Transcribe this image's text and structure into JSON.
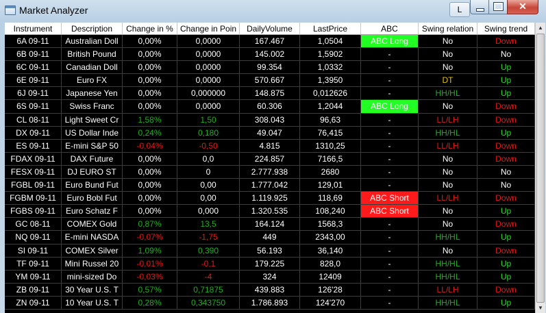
{
  "window": {
    "title": "Market Analyzer",
    "l_button": "L",
    "close_glyph": "✕"
  },
  "columns": [
    "Instrument",
    "Description",
    "Change in %",
    "Change in Poin",
    "DailyVolume",
    "LastPrice",
    "ABC",
    "Swing relation",
    "Swing trend"
  ],
  "colors": {
    "neutral": "#ffffff",
    "positive": "#1fae1f",
    "negative": "#e01818",
    "dt": "#e6c200",
    "abc_long": "#22ff22",
    "abc_short": "#ff1b1b",
    "up": "#2cd82c",
    "down": "#e01818"
  },
  "rows": [
    {
      "instrument": "6A 09-11",
      "description": "Australian Doll",
      "change_pct": "0,00%",
      "change_pts": "0,0000",
      "volume": "167.467",
      "last": "1,0504",
      "abc": "ABC Long",
      "swing_rel": "No",
      "swing_trend": "Down",
      "chg_color": "neutral",
      "rel_color": "neutral",
      "trend_color": "down"
    },
    {
      "instrument": "6B 09-11",
      "description": "British Pound",
      "change_pct": "0,00%",
      "change_pts": "0,0000",
      "volume": "145.002",
      "last": "1,5902",
      "abc": "-",
      "swing_rel": "No",
      "swing_trend": "No",
      "chg_color": "neutral",
      "rel_color": "neutral",
      "trend_color": "neutral"
    },
    {
      "instrument": "6C 09-11",
      "description": "Canadian Doll",
      "change_pct": "0,00%",
      "change_pts": "0,0000",
      "volume": "99.354",
      "last": "1,0332",
      "abc": "-",
      "swing_rel": "No",
      "swing_trend": "Up",
      "chg_color": "neutral",
      "rel_color": "neutral",
      "trend_color": "up"
    },
    {
      "instrument": "6E 09-11",
      "description": "Euro FX",
      "change_pct": "0,00%",
      "change_pts": "0,0000",
      "volume": "570.667",
      "last": "1,3950",
      "abc": "-",
      "swing_rel": "DT",
      "swing_trend": "Up",
      "chg_color": "neutral",
      "rel_color": "dt",
      "trend_color": "up"
    },
    {
      "instrument": "6J 09-11",
      "description": "Japanese Yen",
      "change_pct": "0,00%",
      "change_pts": "0,000000",
      "volume": "148.875",
      "last": "0,012626",
      "abc": "-",
      "swing_rel": "HH/HL",
      "swing_trend": "Up",
      "chg_color": "neutral",
      "rel_color": "positive",
      "trend_color": "up"
    },
    {
      "instrument": "6S 09-11",
      "description": "Swiss Franc",
      "change_pct": "0,00%",
      "change_pts": "0,0000",
      "volume": "60.306",
      "last": "1,2044",
      "abc": "ABC Long",
      "swing_rel": "No",
      "swing_trend": "Down",
      "chg_color": "neutral",
      "rel_color": "neutral",
      "trend_color": "down"
    },
    {
      "instrument": "CL 08-11",
      "description": "Light Sweet Cr",
      "change_pct": "1,58%",
      "change_pts": "1,50",
      "volume": "308.043",
      "last": "96,63",
      "abc": "-",
      "swing_rel": "LL/LH",
      "swing_trend": "Down",
      "chg_color": "positive",
      "rel_color": "negative",
      "trend_color": "down"
    },
    {
      "instrument": "DX 09-11",
      "description": "US Dollar Inde",
      "change_pct": "0,24%",
      "change_pts": "0,180",
      "volume": "49.047",
      "last": "76,415",
      "abc": "-",
      "swing_rel": "HH/HL",
      "swing_trend": "Up",
      "chg_color": "positive",
      "rel_color": "positive",
      "trend_color": "up"
    },
    {
      "instrument": "ES 09-11",
      "description": "E-mini S&P 50",
      "change_pct": "-0,04%",
      "change_pts": "-0,50",
      "volume": "4.815",
      "last": "1310,25",
      "abc": "-",
      "swing_rel": "LL/LH",
      "swing_trend": "Down",
      "chg_color": "negative",
      "rel_color": "negative",
      "trend_color": "down"
    },
    {
      "instrument": "FDAX 09-11",
      "description": "DAX Future",
      "change_pct": "0,00%",
      "change_pts": "0,0",
      "volume": "224.857",
      "last": "7166,5",
      "abc": "-",
      "swing_rel": "No",
      "swing_trend": "Down",
      "chg_color": "neutral",
      "rel_color": "neutral",
      "trend_color": "down"
    },
    {
      "instrument": "FESX 09-11",
      "description": "DJ EURO ST",
      "change_pct": "0,00%",
      "change_pts": "0",
      "volume": "2.777.938",
      "last": "2680",
      "abc": "-",
      "swing_rel": "No",
      "swing_trend": "No",
      "chg_color": "neutral",
      "rel_color": "neutral",
      "trend_color": "neutral"
    },
    {
      "instrument": "FGBL 09-11",
      "description": "Euro Bund Fut",
      "change_pct": "0,00%",
      "change_pts": "0,00",
      "volume": "1.777.042",
      "last": "129,01",
      "abc": "-",
      "swing_rel": "No",
      "swing_trend": "No",
      "chg_color": "neutral",
      "rel_color": "neutral",
      "trend_color": "neutral"
    },
    {
      "instrument": "FGBM 09-11",
      "description": "Euro Bobl Fut",
      "change_pct": "0,00%",
      "change_pts": "0,00",
      "volume": "1.119.925",
      "last": "118,69",
      "abc": "ABC Short",
      "swing_rel": "LL/LH",
      "swing_trend": "Down",
      "chg_color": "neutral",
      "rel_color": "negative",
      "trend_color": "down"
    },
    {
      "instrument": "FGBS 09-11",
      "description": "Euro Schatz F",
      "change_pct": "0,00%",
      "change_pts": "0,000",
      "volume": "1.320.535",
      "last": "108,240",
      "abc": "ABC Short",
      "swing_rel": "No",
      "swing_trend": "Up",
      "chg_color": "neutral",
      "rel_color": "neutral",
      "trend_color": "up"
    },
    {
      "instrument": "GC 08-11",
      "description": "COMEX Gold",
      "change_pct": "0,87%",
      "change_pts": "13,5",
      "volume": "164.124",
      "last": "1568,3",
      "abc": "-",
      "swing_rel": "No",
      "swing_trend": "Down",
      "chg_color": "positive",
      "rel_color": "neutral",
      "trend_color": "down"
    },
    {
      "instrument": "NQ 09-11",
      "description": "E-mini NASDA",
      "change_pct": "-0,07%",
      "change_pts": "-1,75",
      "volume": "449",
      "last": "2343,00",
      "abc": "-",
      "swing_rel": "HH/HL",
      "swing_trend": "Up",
      "chg_color": "negative",
      "rel_color": "positive",
      "trend_color": "up"
    },
    {
      "instrument": "SI 09-11",
      "description": "COMEX Silver",
      "change_pct": "1,09%",
      "change_pts": "0,390",
      "volume": "56.193",
      "last": "36,140",
      "abc": "-",
      "swing_rel": "No",
      "swing_trend": "Down",
      "chg_color": "positive",
      "rel_color": "neutral",
      "trend_color": "down"
    },
    {
      "instrument": "TF 09-11",
      "description": "Mini Russel 20",
      "change_pct": "-0,01%",
      "change_pts": "-0,1",
      "volume": "179.225",
      "last": "828,0",
      "abc": "-",
      "swing_rel": "HH/HL",
      "swing_trend": "Up",
      "chg_color": "negative",
      "rel_color": "positive",
      "trend_color": "up"
    },
    {
      "instrument": "YM 09-11",
      "description": "mini-sized Do",
      "change_pct": "-0,03%",
      "change_pts": "-4",
      "volume": "324",
      "last": "12409",
      "abc": "-",
      "swing_rel": "HH/HL",
      "swing_trend": "Up",
      "chg_color": "negative",
      "rel_color": "positive",
      "trend_color": "up"
    },
    {
      "instrument": "ZB 09-11",
      "description": "30 Year U.S. T",
      "change_pct": "0,57%",
      "change_pts": "0,71875",
      "volume": "439.883",
      "last": "126'28",
      "abc": "-",
      "swing_rel": "LL/LH",
      "swing_trend": "Down",
      "chg_color": "positive",
      "rel_color": "negative",
      "trend_color": "down"
    },
    {
      "instrument": "ZN 09-11",
      "description": "10 Year U.S. T",
      "change_pct": "0,28%",
      "change_pts": "0,343750",
      "volume": "1.786.893",
      "last": "124'270",
      "abc": "-",
      "swing_rel": "HH/HL",
      "swing_trend": "Up",
      "chg_color": "positive",
      "rel_color": "positive",
      "trend_color": "up"
    }
  ]
}
